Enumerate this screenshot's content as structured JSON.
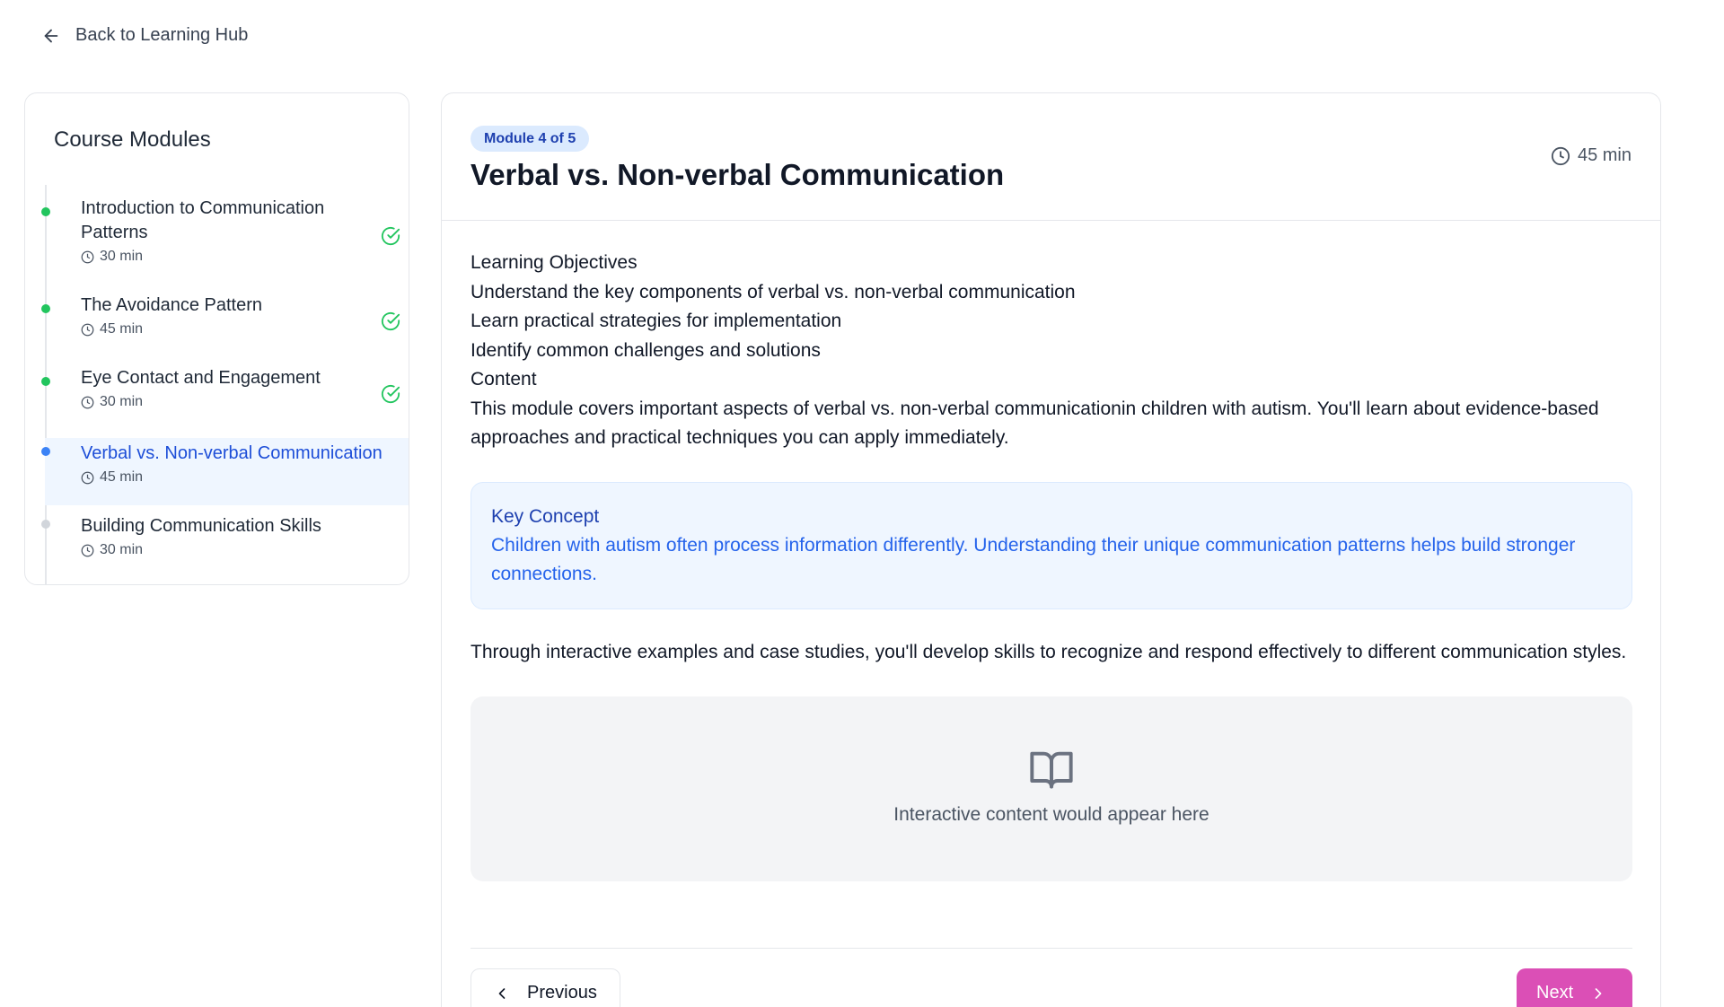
{
  "nav": {
    "back_label": "Back to Learning Hub"
  },
  "sidebar": {
    "title": "Course Modules",
    "modules": [
      {
        "title": "Introduction to Communication Patterns",
        "duration": "30 min",
        "status": "completed"
      },
      {
        "title": "The Avoidance Pattern",
        "duration": "45 min",
        "status": "completed"
      },
      {
        "title": "Eye Contact and Engagement",
        "duration": "30 min",
        "status": "completed"
      },
      {
        "title": "Verbal vs. Non-verbal Communication",
        "duration": "45 min",
        "status": "active"
      },
      {
        "title": "Building Communication Skills",
        "duration": "30 min",
        "status": "pending"
      }
    ]
  },
  "main": {
    "badge": "Module 4 of 5",
    "title": "Verbal vs. Non-verbal Communication",
    "duration": "45 min",
    "objectives_heading": "Learning Objectives",
    "objectives": [
      "Understand the key components of verbal vs. non-verbal communication",
      "Learn practical strategies for implementation",
      "Identify common challenges and solutions"
    ],
    "content_heading": "Content",
    "content_text": "This module covers important aspects of verbal vs. non-verbal communicationin children with autism. You'll learn about evidence-based approaches and practical techniques you can apply immediately.",
    "key_concept": {
      "title": "Key Concept",
      "text": "Children with autism often process information differently. Understanding their unique communication patterns helps build stronger connections."
    },
    "after_text": "Through interactive examples and case studies, you'll develop skills to recognize and respond effectively to different communication styles.",
    "interactive_placeholder": "Interactive content would appear here",
    "prev_label": "Previous",
    "next_label": "Next"
  },
  "colors": {
    "accent_blue": "#1d4ed8",
    "success_green": "#22c55e",
    "next_button": "#db4fb6"
  }
}
